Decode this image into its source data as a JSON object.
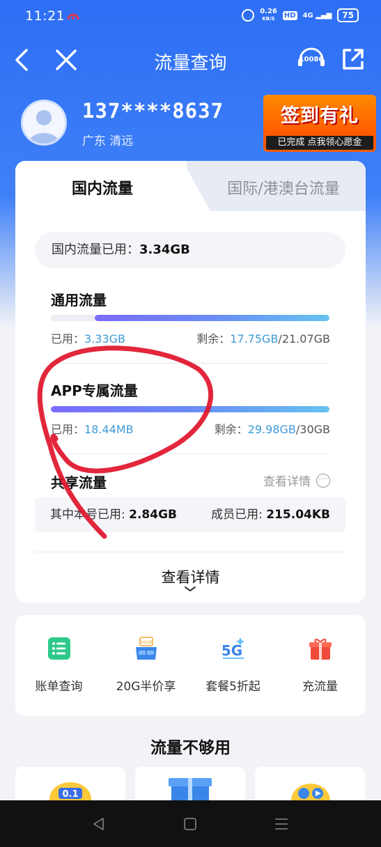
{
  "status_bar": {
    "time": "11:21",
    "net_speed_value": "0.26",
    "net_speed_unit": "KB/S",
    "hd": "HD",
    "signal": "4G",
    "battery": "75"
  },
  "nav": {
    "title": "流量查询",
    "service_number": "10086"
  },
  "user": {
    "phone": "137****8637",
    "location": "广东  清远"
  },
  "promo": {
    "title": "签到有礼",
    "subtitle": "已完成 点我领心愿金"
  },
  "tabs": {
    "domestic": "国内流量",
    "international": "国际/港澳台流量"
  },
  "domestic_used": {
    "label": "国内流量已用：",
    "value": "3.34GB"
  },
  "general": {
    "title": "通用流量",
    "used_label": "已用：",
    "used_value": "3.33GB",
    "remain_label": "剩余：",
    "remain_value": "17.75GB",
    "total": "/21.07GB",
    "remaining_fraction": 0.842
  },
  "app": {
    "title": "APP专属流量",
    "used_label": "已用：",
    "used_value": "18.44MB",
    "remain_label": "剩余：",
    "remain_value": "29.98GB",
    "total": "/30GB",
    "remaining_fraction": 0.999
  },
  "shared": {
    "title": "共享流量",
    "more": "查看详情",
    "main_label": "其中本号已用: ",
    "main_value": "2.84GB",
    "member_label": "成员已用: ",
    "member_value": "215.04KB"
  },
  "details_button": "查看详情",
  "shortcuts": [
    {
      "label": "账单查询",
      "icon": "bill-list-icon",
      "color": "#2ec98a"
    },
    {
      "label": "20G半价享",
      "icon": "half-price-box-icon",
      "color": "#3a86e8"
    },
    {
      "label": "套餐5折起",
      "icon": "5g-icon",
      "color": "#3a86e8"
    },
    {
      "label": "充流量",
      "icon": "gift-box-icon",
      "color": "#f04a3a"
    }
  ],
  "shortcut_20g_badge": "20GB",
  "more_heading": "流量不够用",
  "mini_badge": "0.1",
  "colors": {
    "brand_blue": "#2d6ef5",
    "accent_value": "#3d9bd8",
    "annotation_red": "#e0142a"
  }
}
